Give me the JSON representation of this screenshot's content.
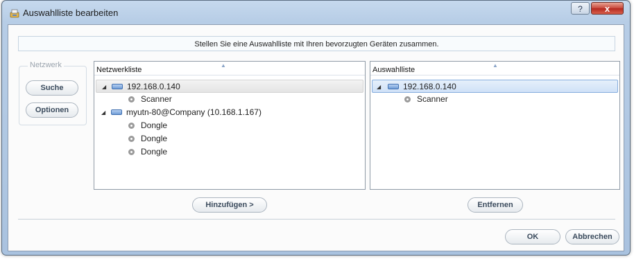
{
  "window": {
    "title": "Auswahlliste bearbeiten",
    "help_label": "?",
    "close_label": "x"
  },
  "instruction": "Stellen Sie eine Auswahlliste mit Ihren bevorzugten Geräten zusammen.",
  "network_group": {
    "label": "Netzwerk",
    "search_label": "Suche",
    "options_label": "Optionen"
  },
  "network_list": {
    "header": "Netzwerkliste",
    "items": [
      {
        "label": "192.168.0.140",
        "type": "network",
        "selected": true
      },
      {
        "label": "Scanner",
        "type": "device"
      },
      {
        "label": "myutn-80@Company (10.168.1.167)",
        "type": "network"
      },
      {
        "label": "Dongle",
        "type": "device"
      },
      {
        "label": "Dongle",
        "type": "device"
      },
      {
        "label": "Dongle",
        "type": "device"
      }
    ]
  },
  "selection_list": {
    "header": "Auswahlliste",
    "items": [
      {
        "label": "192.168.0.140",
        "type": "network",
        "selected": true
      },
      {
        "label": "Scanner",
        "type": "device"
      }
    ]
  },
  "buttons": {
    "add": "Hinzufügen >",
    "remove": "Entfernen",
    "ok": "OK",
    "cancel": "Abbrechen"
  },
  "colors": {
    "titlebar": "#b7cde6",
    "close_button": "#c7463a",
    "selection_blue": "#cfe1f7",
    "network_icon": "#6e9bd6"
  }
}
